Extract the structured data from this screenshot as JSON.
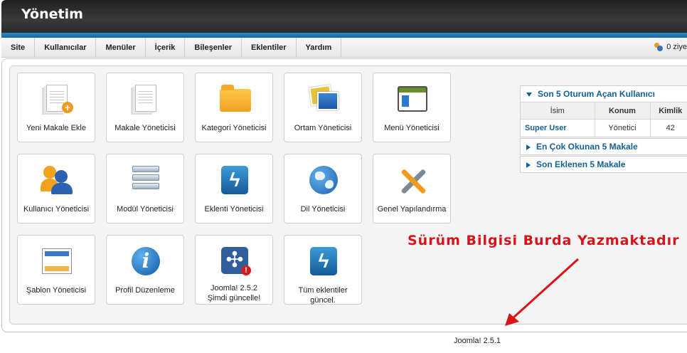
{
  "header": {
    "title": "Yönetim"
  },
  "menu": {
    "items": [
      "Site",
      "Kullanıcılar",
      "Menüler",
      "İçerik",
      "Bileşenler",
      "Eklentiler",
      "Yardım"
    ],
    "visitors": "0 ziye"
  },
  "tiles": [
    {
      "label": "Yeni Makale Ekle",
      "icon": "new-article-icon"
    },
    {
      "label": "Makale Yöneticisi",
      "icon": "article-icon"
    },
    {
      "label": "Kategori Yöneticisi",
      "icon": "folder-icon"
    },
    {
      "label": "Ortam Yöneticisi",
      "icon": "media-icon"
    },
    {
      "label": "Menü Yöneticisi",
      "icon": "menu-window-icon"
    },
    {
      "label": "Kullanıcı Yöneticisi",
      "icon": "users-icon"
    },
    {
      "label": "Modül Yöneticisi",
      "icon": "modules-icon"
    },
    {
      "label": "Eklenti Yöneticisi",
      "icon": "extension-bolt-icon"
    },
    {
      "label": "Dil Yöneticisi",
      "icon": "globe-icon"
    },
    {
      "label": "Genel Yapılandırma",
      "icon": "tools-icon"
    },
    {
      "label": "Şablon Yöneticisi",
      "icon": "template-icon"
    },
    {
      "label": "Profil Düzenleme",
      "icon": "info-icon"
    },
    {
      "label": "Joomla! 2.5.2 Şimdi güncelle!",
      "line1": "Joomla! 2.5.2",
      "line2": "Şimdi güncelle!",
      "icon": "joomla-update-icon"
    },
    {
      "label": "Tüm eklentiler güncel.",
      "icon": "extension-bolt-icon"
    }
  ],
  "side": {
    "logged_in": {
      "title": "Son 5 Oturum Açan Kullanıcı",
      "columns": [
        "İsim",
        "Konum",
        "Kimlik"
      ],
      "rows": [
        {
          "name": "Super User",
          "location": "Yönetici",
          "id": "42"
        }
      ]
    },
    "popular": {
      "title": "En Çok Okunan 5 Makale"
    },
    "latest": {
      "title": "Son Eklenen 5 Makale"
    }
  },
  "annotation": "Sürüm Bilgisi Burda Yazmaktadır",
  "version": "Joomla! 2.5.1",
  "colors": {
    "accent": "#146295",
    "annotation": "#d6141a",
    "band": "#1a72ae"
  }
}
